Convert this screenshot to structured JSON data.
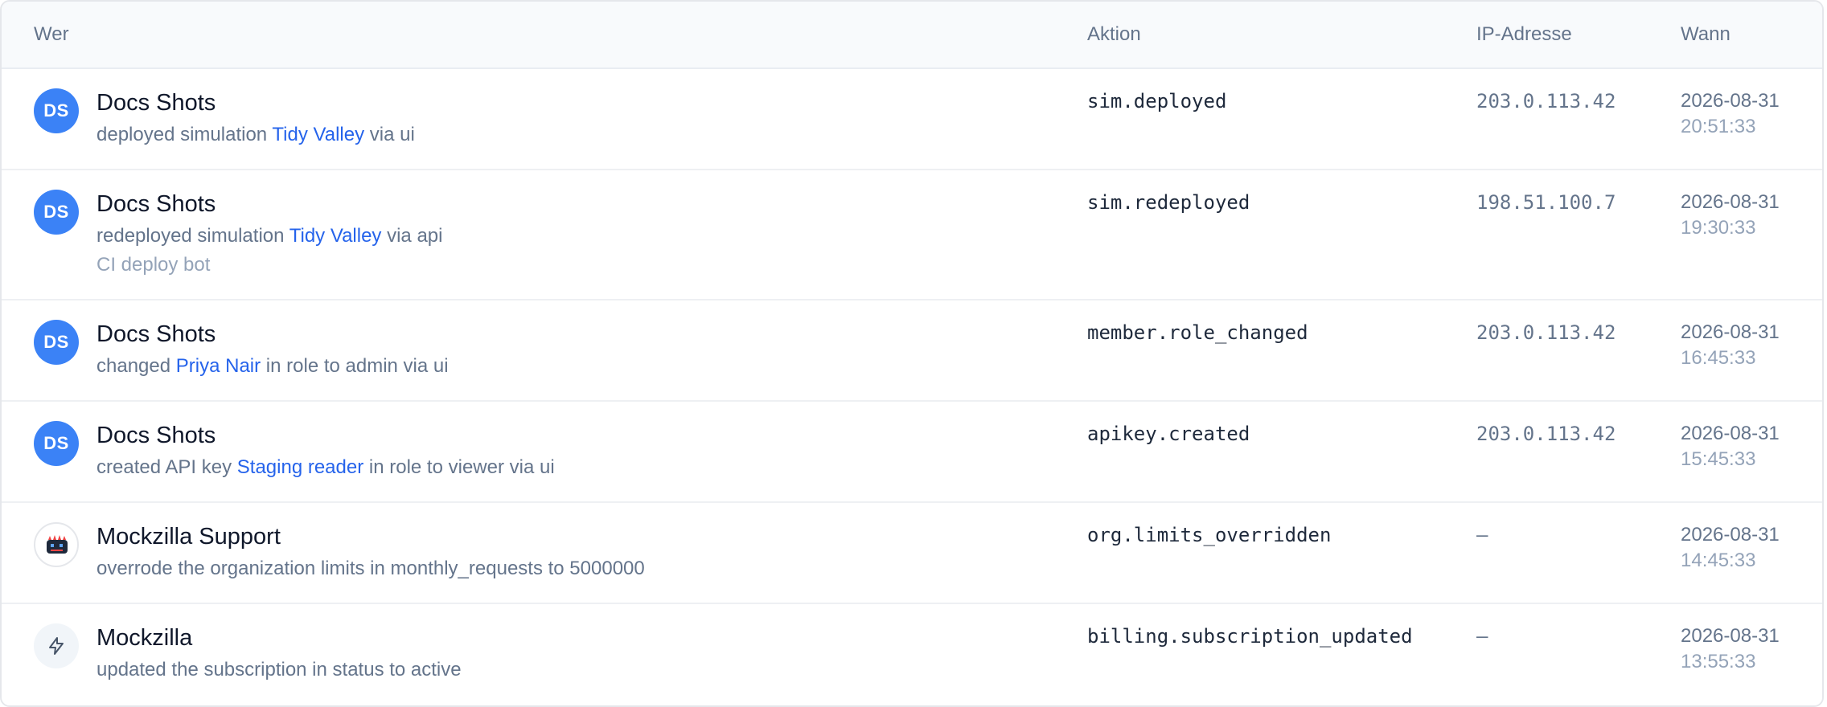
{
  "columns": {
    "who": "Wer",
    "action": "Aktion",
    "ip": "IP-Adresse",
    "when": "Wann"
  },
  "colors": {
    "avatar_bg": "#3b82f6",
    "link": "#2563eb",
    "muted": "#64748b"
  },
  "rows": [
    {
      "avatar": "DS",
      "actor": "Docs Shots",
      "desc_pre": "deployed simulation ",
      "desc_link": "Tidy Valley",
      "desc_post": " via ui",
      "action": "sim.deployed",
      "ip": "203.0.113.42",
      "date": "2026-08-31",
      "time": "20:51:33"
    },
    {
      "avatar": "DS",
      "actor": "Docs Shots",
      "desc_pre": "redeployed simulation ",
      "desc_link": "Tidy Valley",
      "desc_post": " via api",
      "sub": "CI deploy bot",
      "action": "sim.redeployed",
      "ip": "198.51.100.7",
      "date": "2026-08-31",
      "time": "19:30:33"
    },
    {
      "avatar": "DS",
      "actor": "Docs Shots",
      "desc_pre": "changed ",
      "desc_link": "Priya Nair",
      "desc_post": " in role to admin via ui",
      "action": "member.role_changed",
      "ip": "203.0.113.42",
      "date": "2026-08-31",
      "time": "16:45:33"
    },
    {
      "avatar": "DS",
      "actor": "Docs Shots",
      "desc_pre": "created API key ",
      "desc_link": "Staging reader",
      "desc_post": " in role to viewer via ui",
      "action": "apikey.created",
      "ip": "203.0.113.42",
      "date": "2026-08-31",
      "time": "15:45:33"
    },
    {
      "avatar_icon": "mockzilla-logo-icon",
      "actor": "Mockzilla Support",
      "desc_pre": "overrode the organization limits in monthly_requests to 5000000",
      "action": "org.limits_overridden",
      "ip": "–",
      "date": "2026-08-31",
      "time": "14:45:33"
    },
    {
      "avatar_icon": "lightning-icon",
      "actor": "Mockzilla",
      "desc_pre": "updated the subscription in status to active",
      "action": "billing.subscription_updated",
      "ip": "–",
      "date": "2026-08-31",
      "time": "13:55:33"
    }
  ]
}
